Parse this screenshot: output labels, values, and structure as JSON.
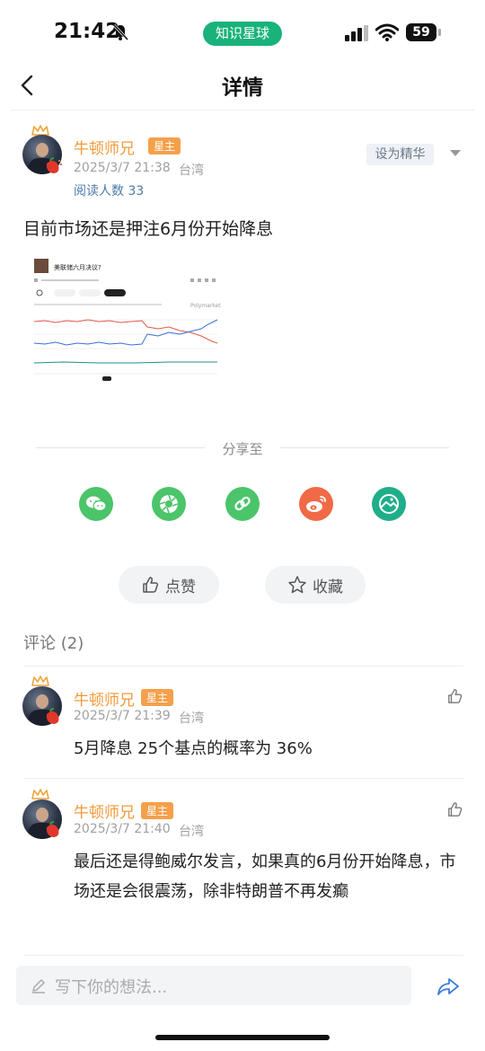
{
  "status_bar": {
    "time": "21:42",
    "app_label": "知识星球",
    "battery": "59"
  },
  "header": {
    "title": "详情"
  },
  "post": {
    "author": "牛顿师兄",
    "badge": "星主",
    "datetime": "2025/3/7 21:38",
    "location": "台湾",
    "reads_label": "阅读人数",
    "reads_count": "33",
    "feature_label": "设为精华",
    "text": "目前市场还是押注6月份开始降息",
    "image": {
      "title": "美联储六月决议?",
      "source": "Polymarket",
      "line_colors": [
        "#3a6fd8",
        "#e05a4e",
        "#1f8f88",
        "#3fb06a"
      ]
    }
  },
  "share": {
    "label": "分享至",
    "icons": [
      {
        "name": "wechat-icon",
        "color": "#4cc46a"
      },
      {
        "name": "moments-icon",
        "color": "#4cc46a"
      },
      {
        "name": "link-icon",
        "color": "#4cc46a"
      },
      {
        "name": "weibo-icon",
        "color": "#f06a46"
      },
      {
        "name": "image-icon",
        "color": "#1fae8a"
      }
    ]
  },
  "actions": {
    "like": "点赞",
    "favorite": "收藏"
  },
  "comments": {
    "title": "评论 (2)",
    "items": [
      {
        "author": "牛顿师兄",
        "badge": "星主",
        "datetime": "2025/3/7 21:39",
        "location": "台湾",
        "text": "5月降息 25个基点的概率为 36%"
      },
      {
        "author": "牛顿师兄",
        "badge": "星主",
        "datetime": "2025/3/7 21:40",
        "location": "台湾",
        "text": "最后还是得鲍威尔发言，如果真的6月份开始降息，市场还是会很震荡，除非特朗普不再发癫"
      }
    ]
  },
  "input": {
    "placeholder": "写下你的想法..."
  },
  "colors": {
    "brand": "#19b27a",
    "username": "#f39a3b",
    "badge": "#f5a04b",
    "reads": "#4e7aa8"
  }
}
